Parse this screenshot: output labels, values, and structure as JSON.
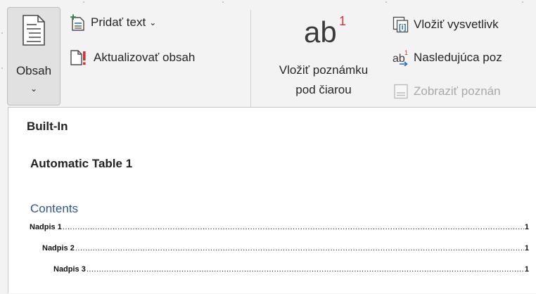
{
  "ribbon": {
    "obsah": {
      "label": "Obsah",
      "chevron": "⌄",
      "icon": "table-of-contents-icon"
    },
    "add_text": {
      "label": "Pridať text",
      "caret": "⌄",
      "icon": "add-text-icon"
    },
    "update": {
      "label": "Aktualizovať obsah",
      "icon": "update-table-icon"
    },
    "footnote": {
      "icon_text": "ab",
      "icon_sup": "1",
      "label_line1": "Vložiť poznámku",
      "label_line2": "pod čiarou"
    },
    "insert_endnote": {
      "label": "Vložiť vysvetlivk",
      "icon": "insert-endnote-icon"
    },
    "next_footnote": {
      "label": "Nasledujúca poz",
      "icon": "next-footnote-icon"
    },
    "show_notes": {
      "label": "Zobraziť poznán",
      "icon": "show-notes-icon",
      "enabled": false
    }
  },
  "dropdown": {
    "section_header": "Built-In",
    "gallery": [
      {
        "title": "Automatic Table 1",
        "contents_heading": "Contents",
        "entries": [
          {
            "text": "Nadpis 1",
            "page": "1",
            "level": 1
          },
          {
            "text": "Nadpis 2",
            "page": "1",
            "level": 2
          },
          {
            "text": "Nadpis 3",
            "page": "1",
            "level": 3
          }
        ]
      }
    ]
  },
  "colors": {
    "accent_red": "#d13438",
    "contents_blue": "#2f5597",
    "icon_blue": "#2b6fb5",
    "icon_green": "#2e8b57"
  }
}
